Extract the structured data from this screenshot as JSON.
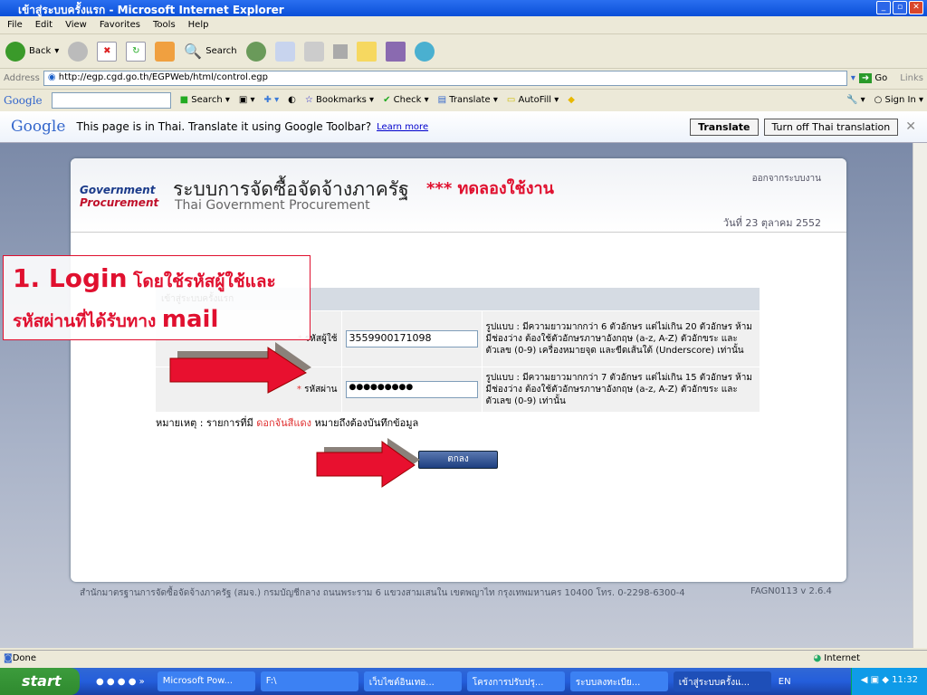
{
  "window": {
    "title": "เข้าสู่ระบบครั้งแรก - Microsoft Internet Explorer"
  },
  "menu": [
    "File",
    "Edit",
    "View",
    "Favorites",
    "Tools",
    "Help"
  ],
  "toolbar": {
    "back": "Back",
    "search": "Search"
  },
  "address": {
    "label": "Address",
    "url": "http://egp.cgd.go.th/EGPWeb/html/control.egp",
    "go": "Go",
    "links": "Links"
  },
  "google_toolbar": {
    "logo": "Google",
    "search": "Search",
    "bookmarks": "Bookmarks",
    "check": "Check",
    "translate": "Translate",
    "autofill": "AutoFill",
    "signin": "Sign In"
  },
  "translate_bar": {
    "logo": "Google",
    "message": "This page is in Thai.  Translate it using Google Toolbar?",
    "learn_more": "Learn more",
    "translate_btn": "Translate",
    "turn_off_btn": "Turn off Thai translation"
  },
  "header": {
    "logo_line1": "Government",
    "logo_line2": "Procurement",
    "title_th": "ระบบการจัดซื้อจัดจ้างภาครัฐ",
    "title_en": "Thai Government Procurement",
    "trial": "*** ทดลองใช้งาน",
    "logout": "ออกจากระบบงาน",
    "date": "วันที่ 23 ตุลาคม 2552"
  },
  "annotation": {
    "line1_a": "1. Login",
    "line1_b": "โดยใช้รหัสผู้ใช้และ",
    "line2_a": "รหัสผ่านที่ได้รับทาง",
    "line2_b": "mail"
  },
  "form": {
    "heading": "เข้าสู่ระบบครั้งแรก",
    "username_label": "รหัสผู้ใช้",
    "username_value": "3559900171098",
    "username_hint": "รูปแบบ : มีความยาวมากกว่า 6 ตัวอักษร แต่ไม่เกิน 20 ตัวอักษร ห้ามมีช่องว่าง ต้องใช้ตัวอักษรภาษาอังกฤษ (a-z, A-Z) ตัวอักขระ และตัวเลข (0-9) เครื่องหมายจุด และขีดเส้นใต้ (Underscore) เท่านั้น",
    "password_label": "รหัสผ่าน",
    "password_value": "●●●●●●●●●",
    "password_hint": "รูปแบบ : มีความยาวมากกว่า 7 ตัวอักษร แต่ไม่เกิน 15 ตัวอักษร ห้ามมีช่องว่าง ต้องใช้ตัวอักษรภาษาอังกฤษ (a-z, A-Z) ตัวอักขระ และตัวเลข (0-9) เท่านั้น",
    "note_a": "หมายเหตุ : รายการที่มี",
    "note_red": "ดอกจันสีแดง",
    "note_b": "หมายถึงต้องบันทึกข้อมูล",
    "required_mark": "*",
    "submit": "ตกลง"
  },
  "footer": {
    "address": "สำนักมาตรฐานการจัดซื้อจัดจ้างภาครัฐ (สมจ.) กรมบัญชีกลาง ถนนพระราม 6 แขวงสามเสนใน เขตพญาไท กรุงเทพมหานคร 10400 โทร. 0-2298-6300-4",
    "version": "FAGN0113 v 2.6.4"
  },
  "status": {
    "text": "Done",
    "zone": "Internet"
  },
  "taskbar": {
    "start": "start",
    "tasks": [
      "Microsoft Pow...",
      "F:\\",
      "เว็บไซต์อินเทอ...",
      "โครงการปรับปรุ...",
      "ระบบลงทะเบีย...",
      "เข้าสู่ระบบครั้งแ..."
    ],
    "lang": "EN",
    "clock": "11:32"
  }
}
